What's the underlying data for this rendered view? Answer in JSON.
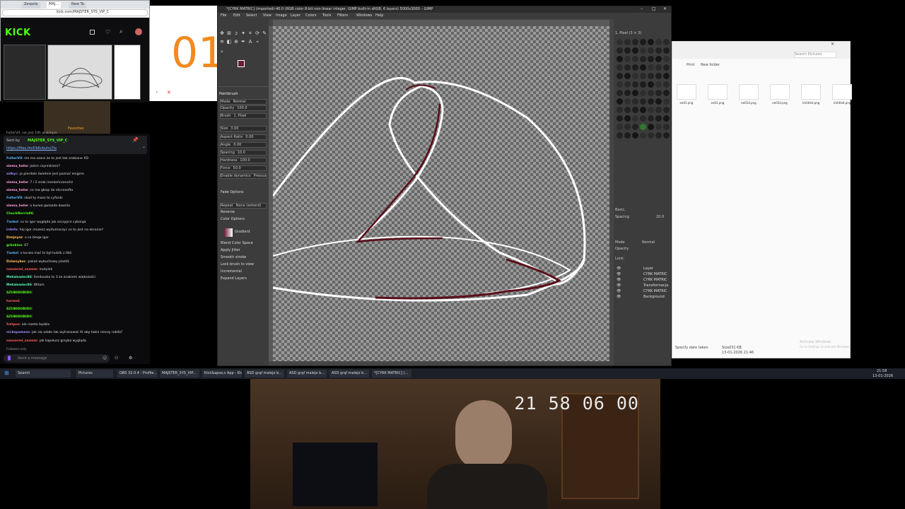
{
  "browser": {
    "tabs": [
      "Zespoły",
      "MAJ...",
      "New Ta"
    ],
    "address": "kick.com/MAJSTER_SYS_VIP_C",
    "logo": "KICK"
  },
  "digits_panel": {
    "text": "01"
  },
  "webcam_small": {
    "label": "Favorites"
  },
  "chat": {
    "top_line": "FolterVII: nie jest 19h w sklepie",
    "pinned_by": "Sent by",
    "pinned_user": "MAJSTER_SYS_VIP_C",
    "pinned_link": "https://files.fm/f/b6vbuhv7tv",
    "messages": [
      {
        "user": "FolterVII",
        "text": "nie ma szans że to jest tak zrobione XD",
        "color": "#5bb8ff"
      },
      {
        "user": "siema_hehe",
        "text": "jakim czynnikiem?",
        "color": "#ff9de2"
      },
      {
        "user": "szlkyc",
        "text": "ja pierdole świetnie jest poznać enigme",
        "color": "#9b8cff"
      },
      {
        "user": "siema_hehe",
        "text": "7 i 2 znak nieskończoności",
        "color": "#ff9de2"
      },
      {
        "user": "siema_hehe",
        "text": "co ma głosp do elicroeofta",
        "color": "#ff9de2"
      },
      {
        "user": "FolterVII",
        "text": "skad ty masz te cyfanki",
        "color": "#5bb8ff"
      },
      {
        "user": "siema_hehe",
        "text": "o kurwa gwiazda dawida",
        "color": "#ff9de2"
      },
      {
        "user": "ChuckNorris96",
        "text": "",
        "color": "#53fc18"
      },
      {
        "user": "7sokol",
        "text": "co to igor wygląda jak szczypce cyborga",
        "color": "#5bb8ff"
      },
      {
        "user": "lrdnfo",
        "text": "hej igor mozesz wytlumaczyc co to jest na ekranie?",
        "color": "#9b8cff"
      },
      {
        "user": "Dzejnysz",
        "text": "o co biega igor",
        "color": "#ffc35b"
      },
      {
        "user": "grbskins",
        "text": "67",
        "color": "#53fc18"
      },
      {
        "user": "7sokol",
        "text": "o kurwa mać to był ludzik z tibii",
        "color": "#5bb8ff"
      },
      {
        "user": "Dziwnykoc",
        "text": "pokaż wybuchowy plastik",
        "color": "#ffc35b"
      },
      {
        "user": "nassermi_sssmm",
        "text": "motylek",
        "color": "#ff5b5b"
      },
      {
        "user": "Metalowiec86",
        "text": "Serduszko to 3 ze znakiem większości",
        "color": "#5bffb8"
      },
      {
        "user": "Metalowiec86",
        "text": "Witam",
        "color": "#5bffb8"
      },
      {
        "user": "SZUBIDUBIDU",
        "text": "",
        "color": "#53fc18"
      },
      {
        "user": "hormel",
        "text": "",
        "color": "#ff5b5b"
      },
      {
        "user": "SZUBIDUBIDU",
        "text": "",
        "color": "#53fc18"
      },
      {
        "user": "SZUBIDUBIDU",
        "text": "",
        "color": "#53fc18"
      },
      {
        "user": "fretpos",
        "text": "ale rozeta będzie",
        "color": "#ff5b5b"
      },
      {
        "user": "nickspamesz",
        "text": "Jak się udało tak wytrasować AI aby takie rzeczy robiła?",
        "color": "#9b8cff"
      },
      {
        "user": "nassermi_sssmm",
        "text": "jak kapelusz grzyba wygląda",
        "color": "#ff5b5b"
      }
    ],
    "followers_only": "Followers only",
    "input_placeholder": "Send a message"
  },
  "gimp": {
    "title": "*[CYRK MATRIC] (imported)-40.0 (RGB color 8-bit non-linear integer, GIMP built-in sRGB, 6 layers) 5000x3000 – GIMP",
    "menu": [
      "File",
      "Edit",
      "Select",
      "View",
      "Image",
      "Layer",
      "Colors",
      "Tools",
      "Filters",
      "Windows",
      "Help"
    ],
    "tool_options": {
      "header": "Paintbrush",
      "mode_label": "Mode",
      "mode_value": "Normal",
      "opacity_label": "Opacity",
      "opacity_value": "100.0",
      "brush_label": "Brush",
      "brush_value": "1. Pixel",
      "size_label": "Size",
      "size_value": "3.00",
      "aspect_label": "Aspect Ratio",
      "aspect_value": "0.00",
      "angle_label": "Angle",
      "angle_value": "0.00",
      "spacing_label": "Spacing",
      "spacing_value": "10.0",
      "hardness_label": "Hardness",
      "hardness_value": "100.0",
      "force_label": "Force",
      "force_value": "50.0",
      "dynamics_label": "Enable dynamics",
      "dynamics_value": "Pressure Size",
      "fade_label": "Fade Options",
      "repeat_label": "Repeat",
      "repeat_value": "None (extend)",
      "reverse_label": "Reverse",
      "color_label": "Color Options",
      "gradient_label": "Gradient",
      "blend_label": "Blend Color Space",
      "apply_jitter": "Apply Jitter",
      "smooth": "Smooth stroke",
      "lock": "Lock brush to view",
      "incremental": "Incremental",
      "expand": "Expand Layers"
    },
    "dock": {
      "brush_panel_title": "1. Pixel (3 × 3)",
      "basic_label": "Basic,",
      "spacing_label": "Spacing",
      "spacing_value": "20.0",
      "mode_label": "Mode",
      "mode_value": "Normal",
      "opacity_label": "Opacity",
      "lock_label": "Lock:",
      "layers": [
        "Layer",
        "CYRK MATRIC",
        "CYRK MATRIC",
        "Transformacja",
        "CYRK MATRIC",
        "Background"
      ]
    }
  },
  "explorer": {
    "search_placeholder": "Search Pictures",
    "toolbar": [
      "Print",
      "New folder"
    ],
    "files": [
      "ee01.png",
      "ee01.png",
      "ee01d.png",
      "ee01d.png",
      "Untitled.png",
      "Untitled.png"
    ],
    "status_left": "Specify date taken",
    "status_size_label": "Size:",
    "status_size": "231 KB",
    "status_date": "13-01-2026 21:46",
    "activate": "Activate Windows",
    "activate_sub": "Go to Settings to activate Windows."
  },
  "taskbar": {
    "search": "Search",
    "items": [
      "Pictures",
      "OBS 32.0.4 - Profile...",
      "MAJSTER_SYS_VIP...",
      "Kick&apos;s App - Kick C...",
      "ASD grąf malejo b...",
      "ASD grąf malejo b...",
      "ASD grąf malejo b...",
      "*[CYRK MATRIC] (..."
    ],
    "time": "21:58",
    "date": "13-01-2026"
  },
  "webcam": {
    "timestamp": "21 58 06 00"
  }
}
